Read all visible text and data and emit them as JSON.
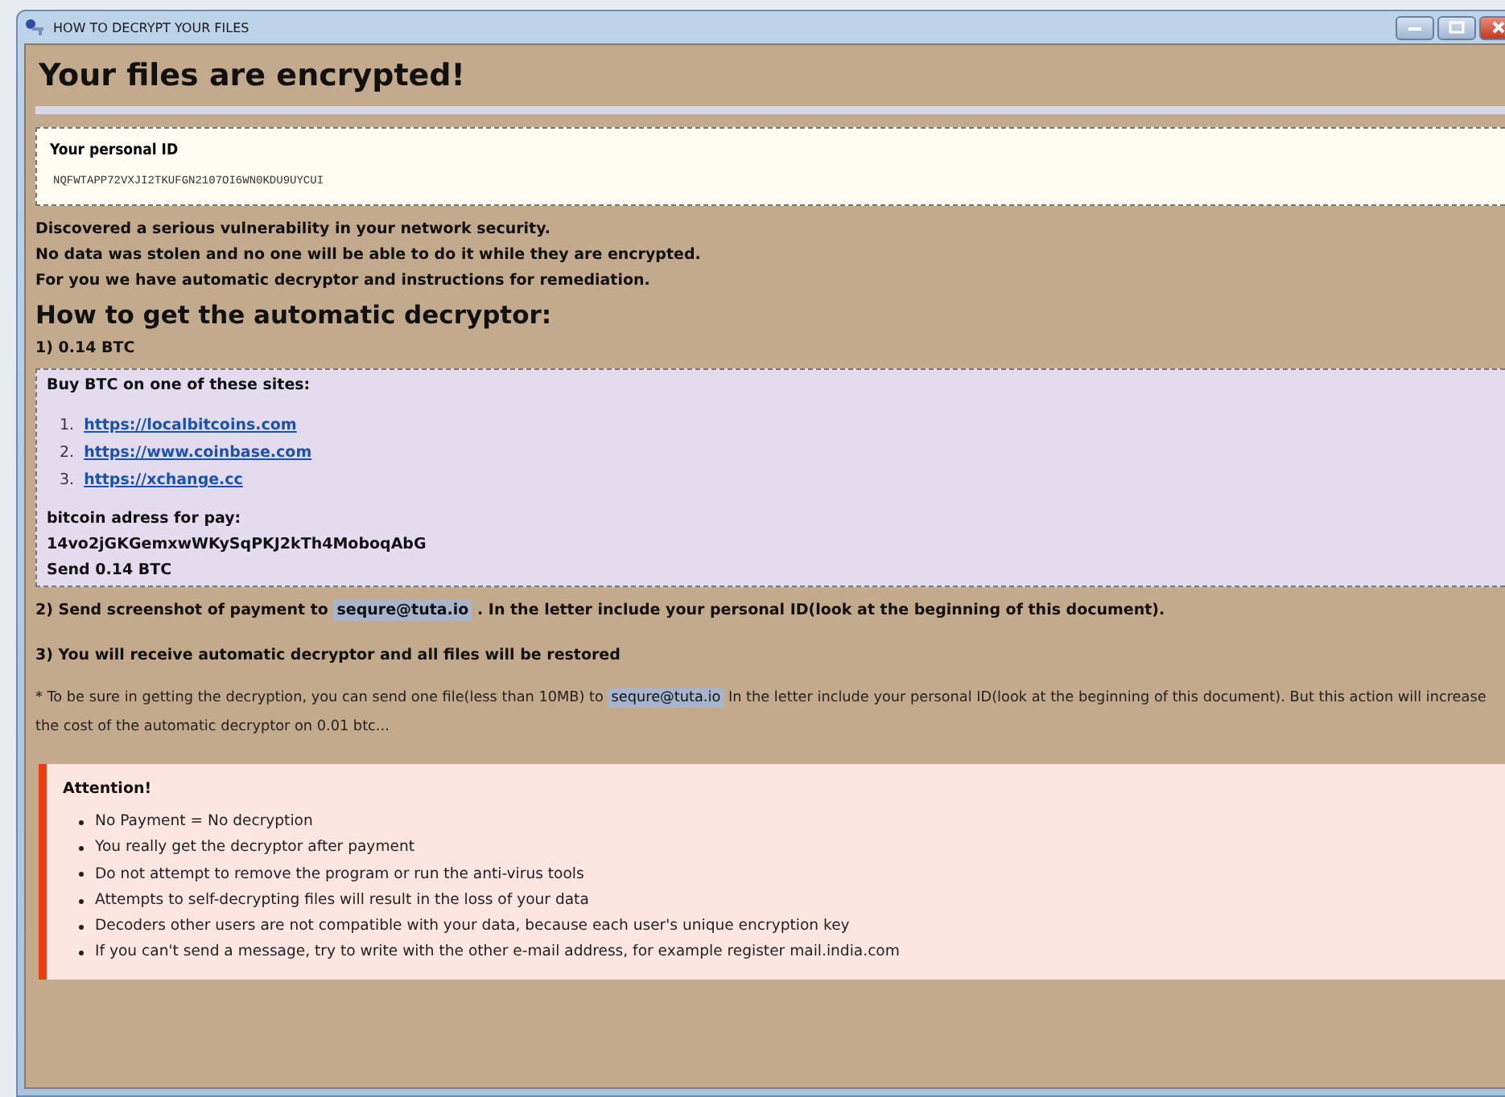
{
  "window": {
    "title": "HOW TO DECRYPT YOUR FILES"
  },
  "heading": "Your files are encrypted!",
  "personal_id": {
    "label": "Your personal ID",
    "value": "NQFWTAPP72VXJI2TKUFGN2107OI6WN0KDU9UYCUI"
  },
  "intro": [
    "Discovered a serious vulnerability in your network security.",
    "No data was stolen and no one will be able to do it while they are encrypted.",
    "For you we have automatic decryptor and instructions for remediation."
  ],
  "subheading": "How to get the automatic decryptor:",
  "step_1": "1) 0.14 BTC",
  "payment_box": {
    "title": "Buy BTC on one of these sites:",
    "sites": [
      {
        "number": "1.",
        "url": "https://localbitcoins.com"
      },
      {
        "number": "2.",
        "url": "https://www.coinbase.com"
      },
      {
        "number": "3.",
        "url": "https://xchange.cc"
      }
    ],
    "address_label": "bitcoin adress for pay:",
    "address": "14vo2jGKGemxwWKySqPKJ2kTh4MoboqAbG",
    "amount": "Send 0.14 BTC"
  },
  "step_2": {
    "before": "2) Send screenshot of payment to",
    "email": "sequre@tuta.io",
    "after": ". In the letter include your personal ID(look at the beginning of this document)."
  },
  "step_3": "3) You will receive automatic decryptor and all files will be restored",
  "note": {
    "before": "* To be sure in getting the decryption, you can send one file(less than 10MB) to",
    "email": "sequre@tuta.io",
    "after": "In the letter include your personal ID(look at the beginning of this document). But this action will increase the cost of the automatic decryptor on 0.01 btc..."
  },
  "attention": {
    "title": "Attention!",
    "items": [
      "No Payment = No decryption",
      "You really get the decryptor after payment",
      "Do not attempt to remove the program or run the anti-virus tools",
      "Attempts to self-decrypting files will result in the loss of your data",
      "Decoders other users are not compatible with your data, because each user's unique encryption key",
      "If you can't send a message, try to write with the other e-mail address, for example register mail.india.com"
    ]
  }
}
